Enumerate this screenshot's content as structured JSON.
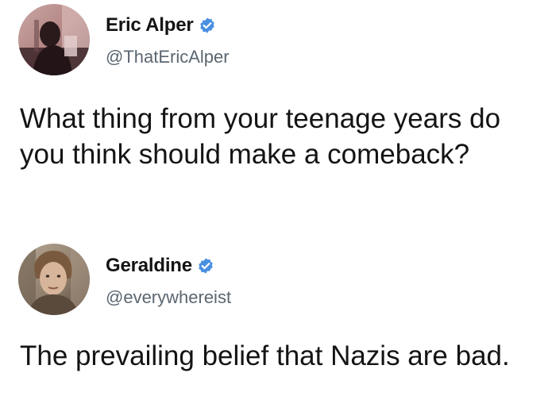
{
  "tweets": [
    {
      "author": {
        "name": "Eric Alper",
        "handle": "@ThatEricAlper",
        "verified": true,
        "avatar": "profile-photo"
      },
      "text": "What thing from your teenage years do you think should make a comeback?"
    },
    {
      "author": {
        "name": "Geraldine",
        "handle": "@everywhereist",
        "verified": true,
        "avatar": "profile-photo"
      },
      "text": "The prevailing belief that Nazis are bad."
    }
  ],
  "colors": {
    "verified_badge": "#4a90e2",
    "handle_text": "#5b6670",
    "body_text": "#141414",
    "background": "#ffffff"
  },
  "icons": {
    "verified": "verified-badge-icon"
  }
}
